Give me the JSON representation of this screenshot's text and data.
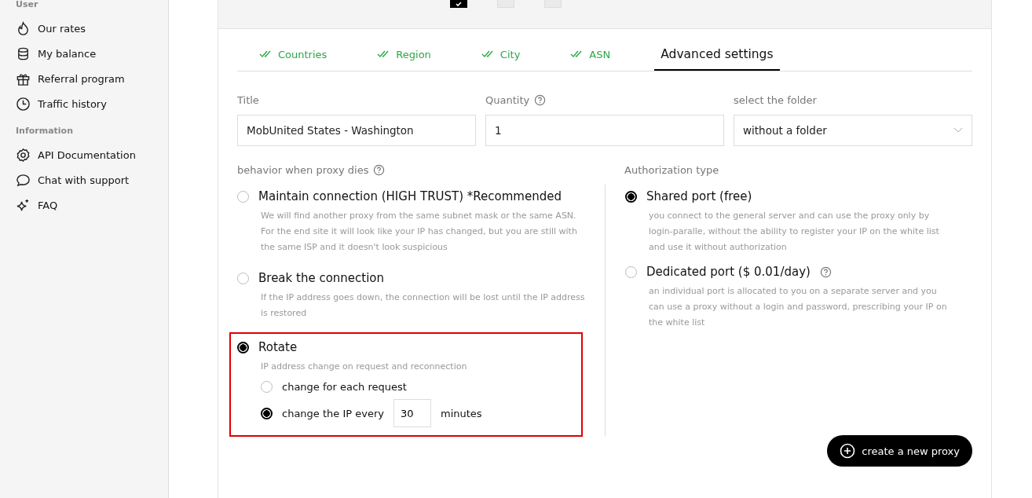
{
  "sidebar": {
    "sections": [
      {
        "heading": "User",
        "items": [
          {
            "label": "Our rates"
          },
          {
            "label": "My balance"
          },
          {
            "label": "Referral program"
          },
          {
            "label": "Traffic history"
          }
        ]
      },
      {
        "heading": "Information",
        "items": [
          {
            "label": "API Documentation"
          },
          {
            "label": "Chat with support"
          },
          {
            "label": "FAQ"
          }
        ]
      }
    ]
  },
  "top_checkboxes": [
    {
      "checked": true
    },
    {
      "checked": false
    },
    {
      "checked": false
    }
  ],
  "tabs": [
    {
      "label": "Countries",
      "done": true,
      "selected": false
    },
    {
      "label": "Region",
      "done": true,
      "selected": false
    },
    {
      "label": "City",
      "done": true,
      "selected": false
    },
    {
      "label": "ASN",
      "done": true,
      "selected": false
    },
    {
      "label": "Advanced settings",
      "done": false,
      "selected": true
    }
  ],
  "fields": [
    {
      "label": "Title",
      "kind": "text",
      "value": "MobUnited States - Washington",
      "help": false
    },
    {
      "label": "Quantity",
      "kind": "text",
      "value": "1",
      "help": true
    },
    {
      "label": "select the folder",
      "kind": "select",
      "value": "without a folder",
      "help": false
    }
  ],
  "behavior": {
    "label": "behavior when proxy dies",
    "help": true,
    "options": [
      {
        "title": "Maintain connection (HIGH TRUST) *Recommended",
        "description": "We will find another proxy from the same subnet mask or the same ASN. For the end site it will look like your IP has changed, but you are still with the same ISP and it doesn't look suspicious",
        "selected": false,
        "highlighted": false
      },
      {
        "title": "Break the connection",
        "description": "If the IP address goes down, the connection will be lost until the IP address is restored",
        "selected": false,
        "highlighted": false
      },
      {
        "title": "Rotate",
        "description": "IP address change on request and reconnection",
        "selected": true,
        "highlighted": true,
        "sub_options": [
          {
            "label": "change for each request",
            "selected": false
          },
          {
            "label": "change the IP every",
            "selected": true,
            "value": "30",
            "unit": "minutes"
          }
        ]
      }
    ]
  },
  "authorization": {
    "label": "Authorization type",
    "options": [
      {
        "title": "Shared port (free)",
        "help": false,
        "description": "you connect to the general server and can use the proxy only by login-paralle, without the ability to register your IP on the white list and use it without authorization",
        "selected": true
      },
      {
        "title": "Dedicated port ($ 0.01/day)",
        "help": true,
        "description": "an individual port is allocated to you on a separate server and you can use a proxy without a login and password, prescribing your IP on the white list",
        "selected": false
      }
    ]
  },
  "create_button": "create a new proxy"
}
